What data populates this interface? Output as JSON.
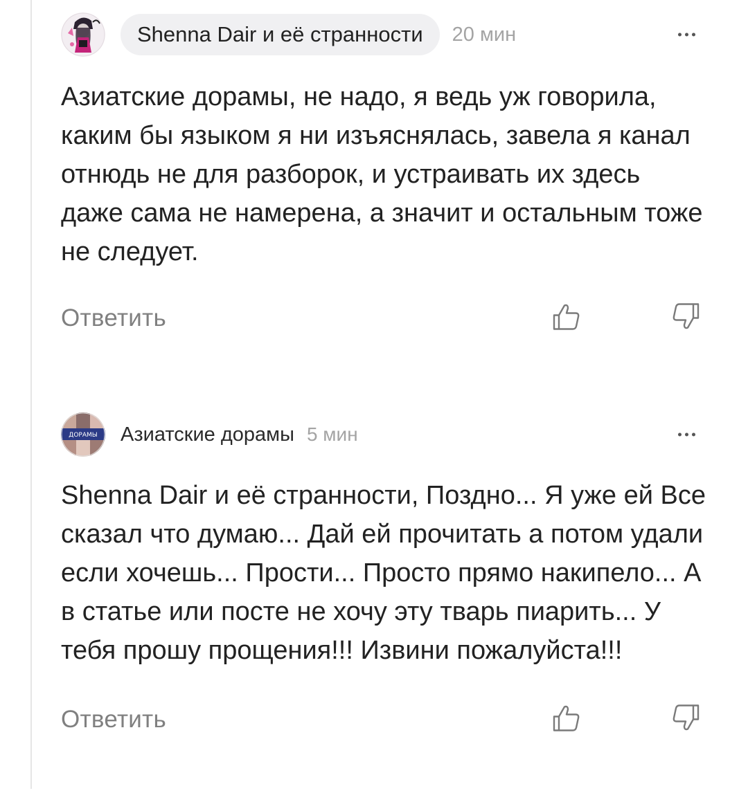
{
  "comments": [
    {
      "author": "Shenna Dair и её странности",
      "time": "20 мин",
      "text": "Азиатские дорамы, не надо, я ведь уж говорила, каким бы языком я ни изъяснялась, завела я канал отнюдь не для разборок, и устраивать их здесь даже сама не намерена, а значит и остальным тоже не следует.",
      "reply_label": "Ответить"
    },
    {
      "author": "Азиатские дорамы",
      "avatar_label": "ДОРАМЫ",
      "time": "5 мин",
      "text": "Shenna Dair и её странности, Поздно... Я уже ей Все сказал что думаю... Дай ей прочитать а потом удали если хочешь... Прости... Просто прямо накипело... А в статье или посте не хочу эту тварь пиарить... У тебя прошу прощения!!! Извини пожалуйста!!!",
      "reply_label": "Ответить"
    }
  ],
  "icons": {
    "like": "thumbs-up-icon",
    "dislike": "thumbs-down-icon",
    "more": "more-dots-icon"
  },
  "colors": {
    "pill_bg": "#f0f0f2",
    "muted": "#808080",
    "time": "#a4a4a4",
    "text": "#222222"
  }
}
